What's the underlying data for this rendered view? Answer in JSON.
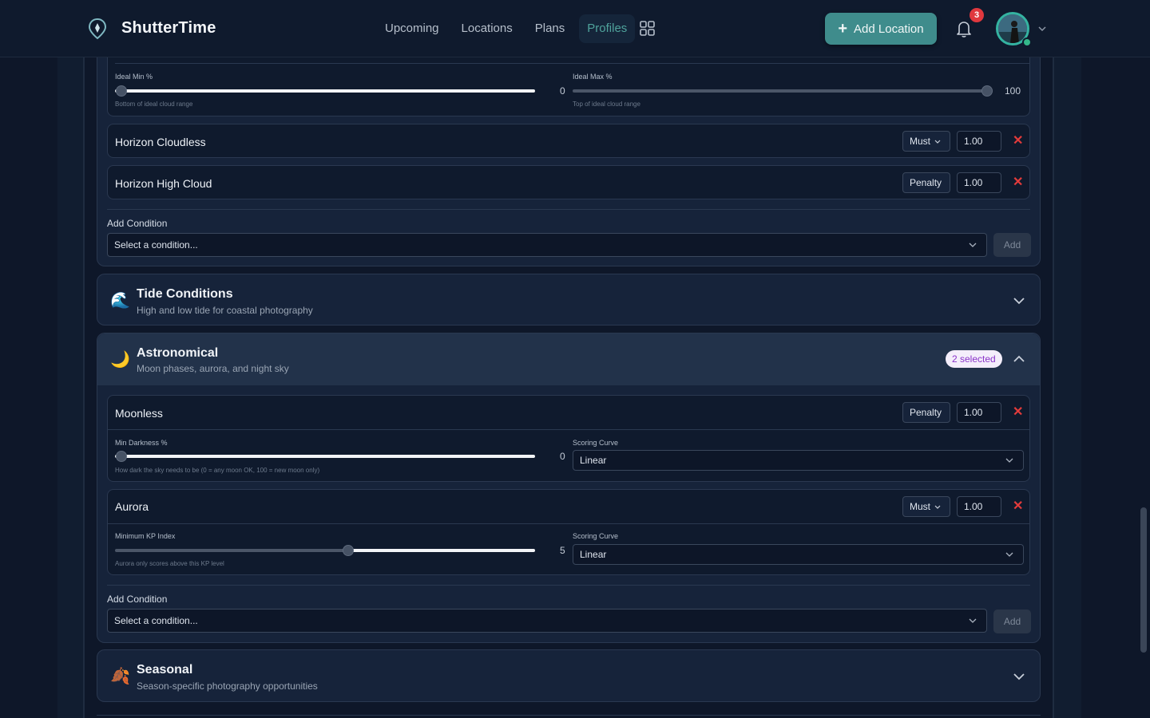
{
  "app": {
    "brand": "ShutterTime"
  },
  "nav": {
    "items": [
      "Upcoming",
      "Locations",
      "Plans",
      "Profiles"
    ],
    "active": "Profiles"
  },
  "header": {
    "add_location": "Add Location",
    "notification_count": "3"
  },
  "cloud": {
    "ideal_min_label": "Ideal Min %",
    "ideal_min_value": "0",
    "ideal_min_hint": "Bottom of ideal cloud range",
    "ideal_max_label": "Ideal Max %",
    "ideal_max_value": "100",
    "ideal_max_hint": "Top of ideal cloud range",
    "conditions": [
      {
        "name": "Horizon Cloudless",
        "mode": "Must",
        "weight": "1.00"
      },
      {
        "name": "Horizon High Cloud",
        "mode": "Penalty",
        "weight": "1.00"
      }
    ],
    "add_condition_label": "Add Condition",
    "select_placeholder": "Select a condition...",
    "add_button": "Add"
  },
  "tide": {
    "title": "Tide Conditions",
    "subtitle": "High and low tide for coastal photography",
    "icon": "wave-icon"
  },
  "astro": {
    "title": "Astronomical",
    "subtitle": "Moon phases, aurora, and night sky",
    "icon": "crescent-moon-icon",
    "selected_badge": "2 selected",
    "moonless": {
      "name": "Moonless",
      "mode": "Penalty",
      "weight": "1.00",
      "slider_label": "Min Darkness %",
      "slider_value": "0",
      "slider_hint": "How dark the sky needs to be (0 = any moon OK, 100 = new moon only)",
      "curve_label": "Scoring Curve",
      "curve_value": "Linear"
    },
    "aurora": {
      "name": "Aurora",
      "mode": "Must",
      "weight": "1.00",
      "slider_label": "Minimum KP Index",
      "slider_value": "5",
      "slider_hint": "Aurora only scores above this KP level",
      "curve_label": "Scoring Curve",
      "curve_value": "Linear"
    },
    "add_condition_label": "Add Condition",
    "select_placeholder": "Select a condition...",
    "add_button": "Add"
  },
  "seasonal": {
    "title": "Seasonal",
    "subtitle": "Season-specific photography opportunities",
    "icon": "autumn-leaf-icon"
  },
  "colors": {
    "accent": "#3f8c8c",
    "background": "#0e1729",
    "danger": "#e23b3b",
    "badge_purple": "#8a33c9"
  }
}
